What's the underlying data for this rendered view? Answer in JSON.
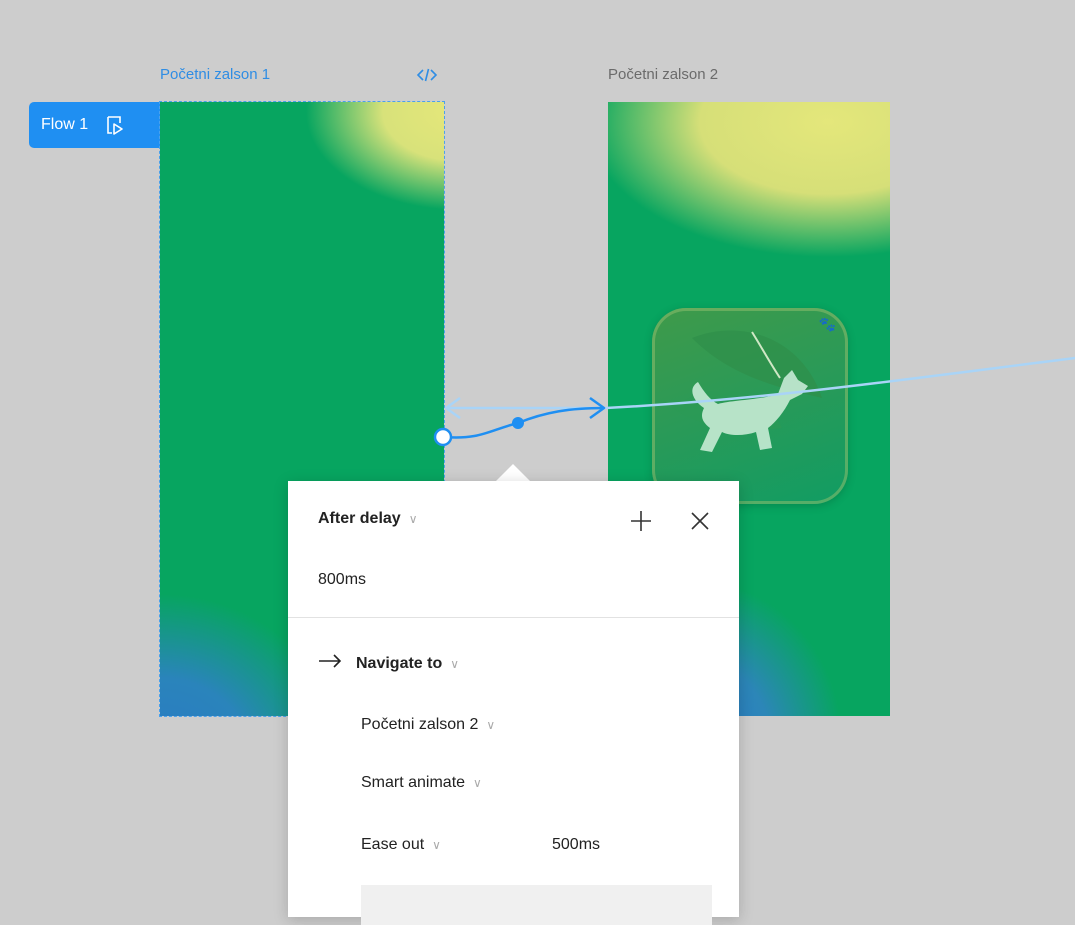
{
  "canvas": {
    "frame1_title": "Početni zalson 1",
    "frame2_title": "Početni zalson 2"
  },
  "flow": {
    "label": "Flow 1"
  },
  "interaction": {
    "trigger": "After delay",
    "delay": "800ms",
    "action": "Navigate to",
    "destination": "Početni zalson 2",
    "animation": "Smart animate",
    "easing": "Ease out",
    "duration": "500ms"
  },
  "icons": {
    "code": "code-icon",
    "flow_play": "play-frame-icon",
    "add": "plus-icon",
    "close": "close-icon",
    "arrow": "arrow-right-icon",
    "paw": "paw-icon"
  },
  "colors": {
    "accent": "#1f8ff2",
    "canvas": "#cdcdcd",
    "frame_green": "#07a560"
  }
}
